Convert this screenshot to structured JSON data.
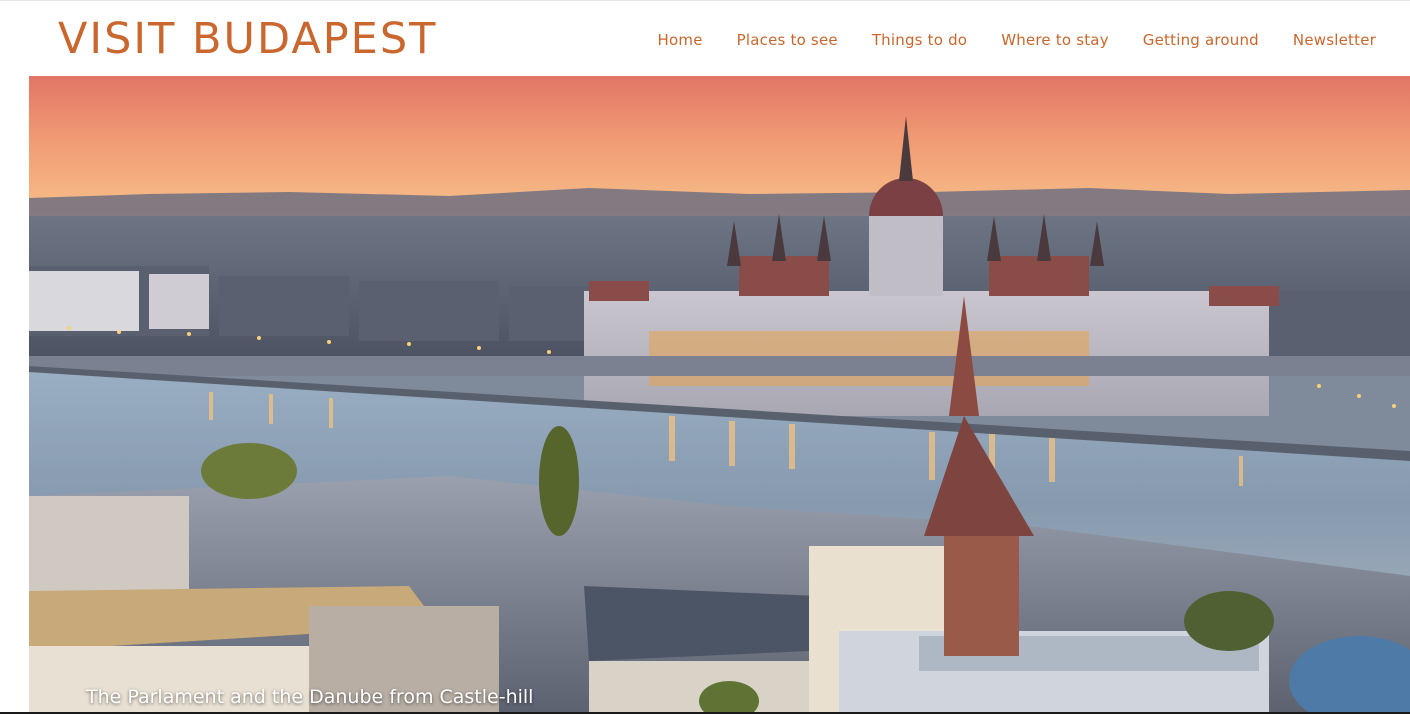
{
  "site": {
    "logo_text": "VISIT BUDAPEST"
  },
  "nav": {
    "items": [
      {
        "label": "Home"
      },
      {
        "label": "Places to see"
      },
      {
        "label": "Things to do"
      },
      {
        "label": "Where to stay"
      },
      {
        "label": "Getting around"
      },
      {
        "label": "Newsletter"
      }
    ]
  },
  "hero": {
    "caption": "The Parlament and the Danube from Castle-hill"
  },
  "colors": {
    "brand": "#c9672e",
    "sky_top": "#e67f6a",
    "sky_bottom": "#f5b07a",
    "river": "#8fa3b9"
  }
}
